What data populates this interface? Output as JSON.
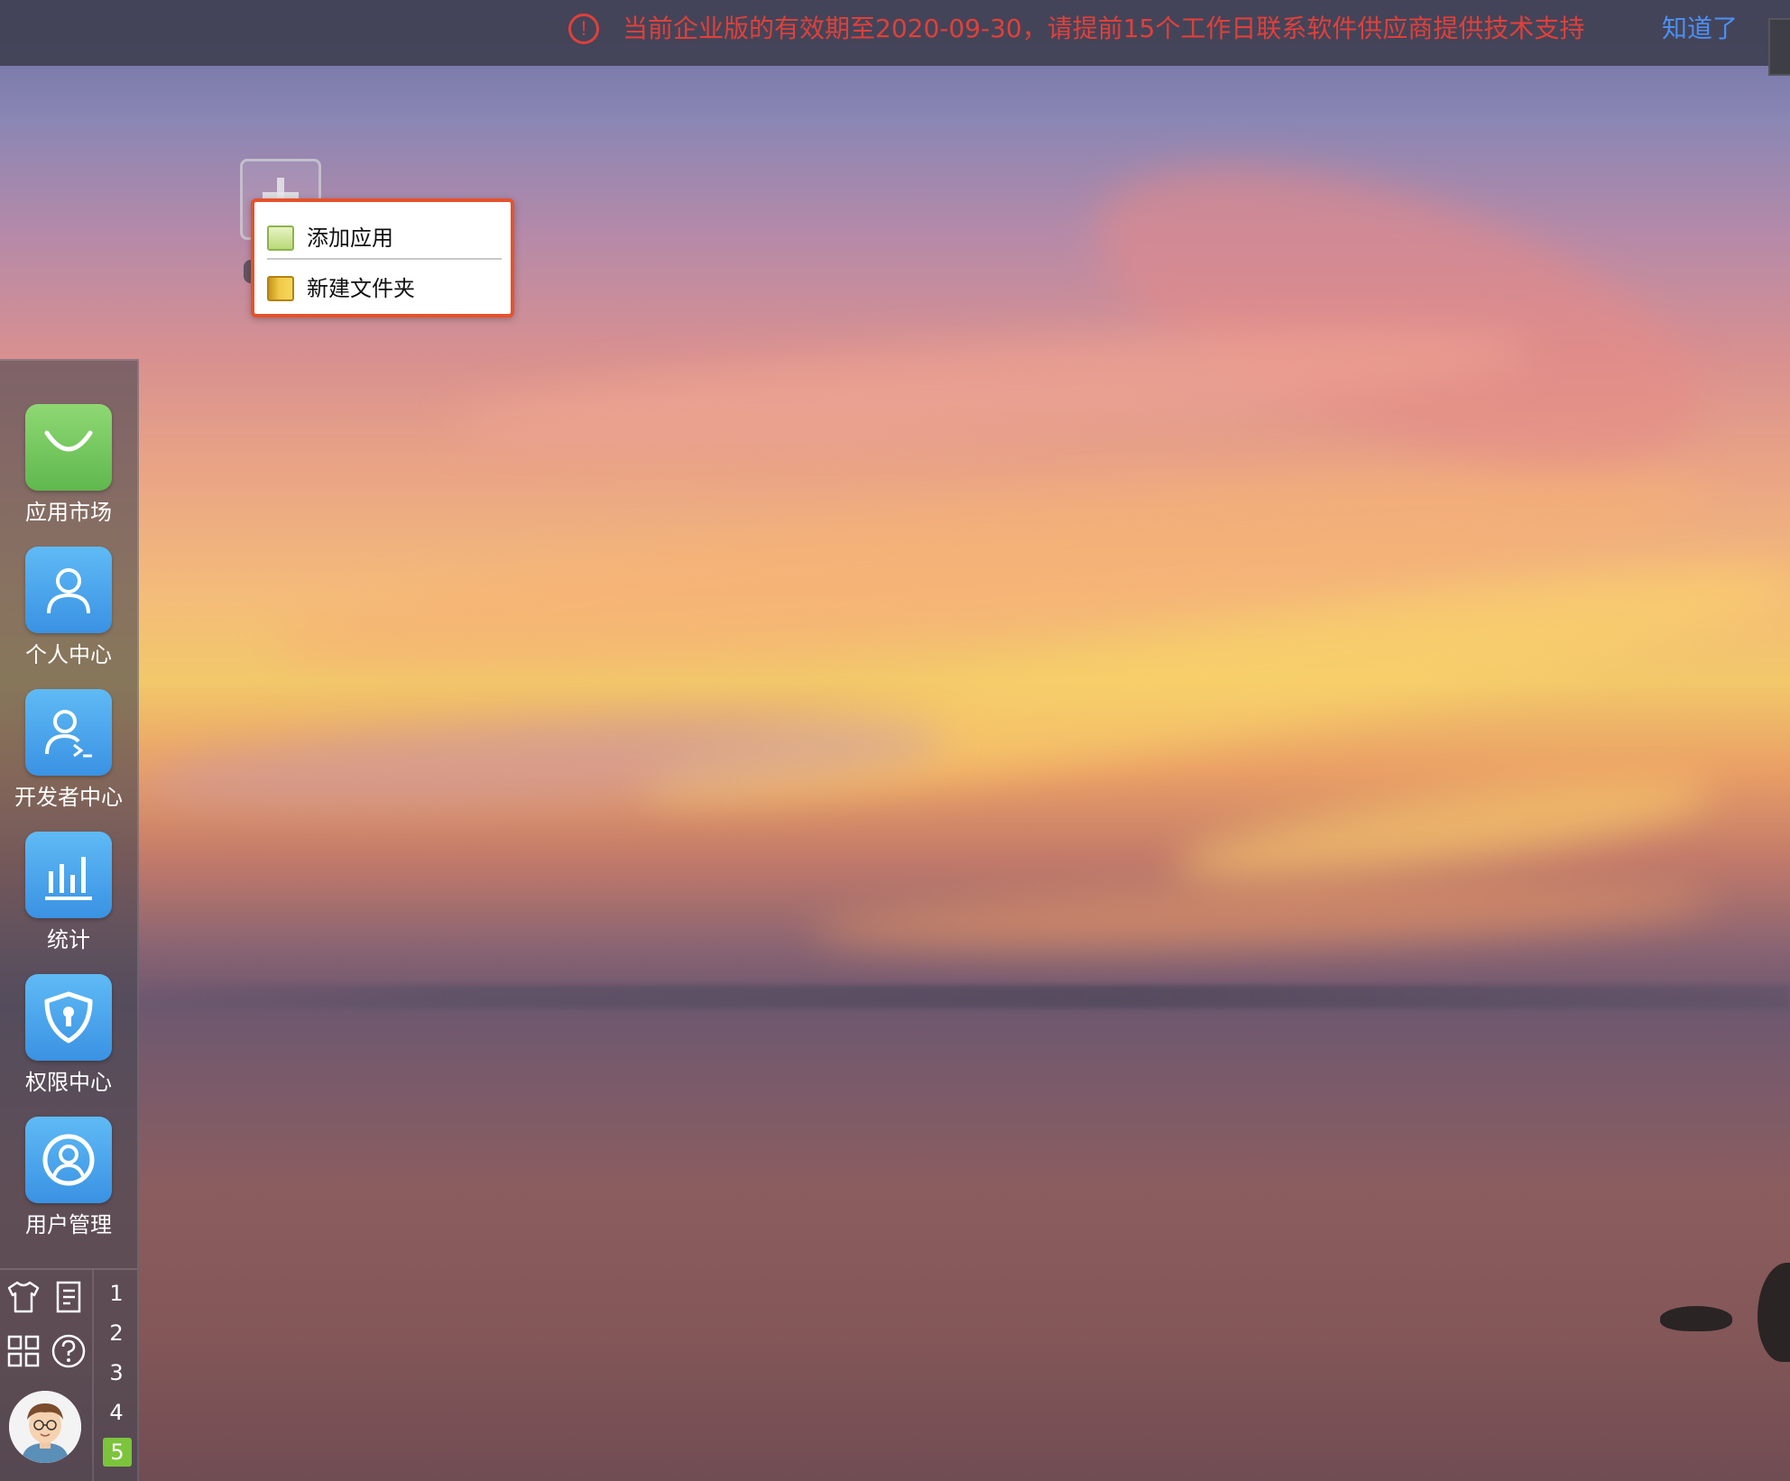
{
  "notification": {
    "icon": "warning-circle-icon",
    "message": "当前企业版的有效期至2020-09-30，请提前15个工作日联系软件供应商提供技术支持",
    "dismiss_label": "知道了",
    "message_color": "#e0403a",
    "dismiss_color": "#4d8ff0"
  },
  "context_menu": {
    "items": [
      {
        "label": "添加应用",
        "icon": "add-app-icon"
      },
      {
        "label": "新建文件夹",
        "icon": "new-folder-icon"
      }
    ],
    "highlight_color": "#e4532b"
  },
  "dock": {
    "apps": [
      {
        "label": "应用市场",
        "icon": "shopping-bag-icon",
        "color": "#6cc35a"
      },
      {
        "label": "个人中心",
        "icon": "person-icon",
        "color": "#4aa3ec"
      },
      {
        "label": "开发者中心",
        "icon": "developer-person-icon",
        "color": "#4aa3ec"
      },
      {
        "label": "统计",
        "icon": "bar-chart-icon",
        "color": "#4aa3ec"
      },
      {
        "label": "权限中心",
        "icon": "shield-icon",
        "color": "#4aa3ec"
      },
      {
        "label": "用户管理",
        "icon": "user-circle-icon",
        "color": "#4aa3ec"
      }
    ],
    "tools": [
      {
        "icon": "shirt-icon"
      },
      {
        "icon": "notes-icon"
      },
      {
        "icon": "grid-icon"
      },
      {
        "icon": "help-icon"
      }
    ],
    "pages": [
      "1",
      "2",
      "3",
      "4",
      "5"
    ],
    "active_page": "5",
    "active_page_color": "#7cc43c"
  }
}
